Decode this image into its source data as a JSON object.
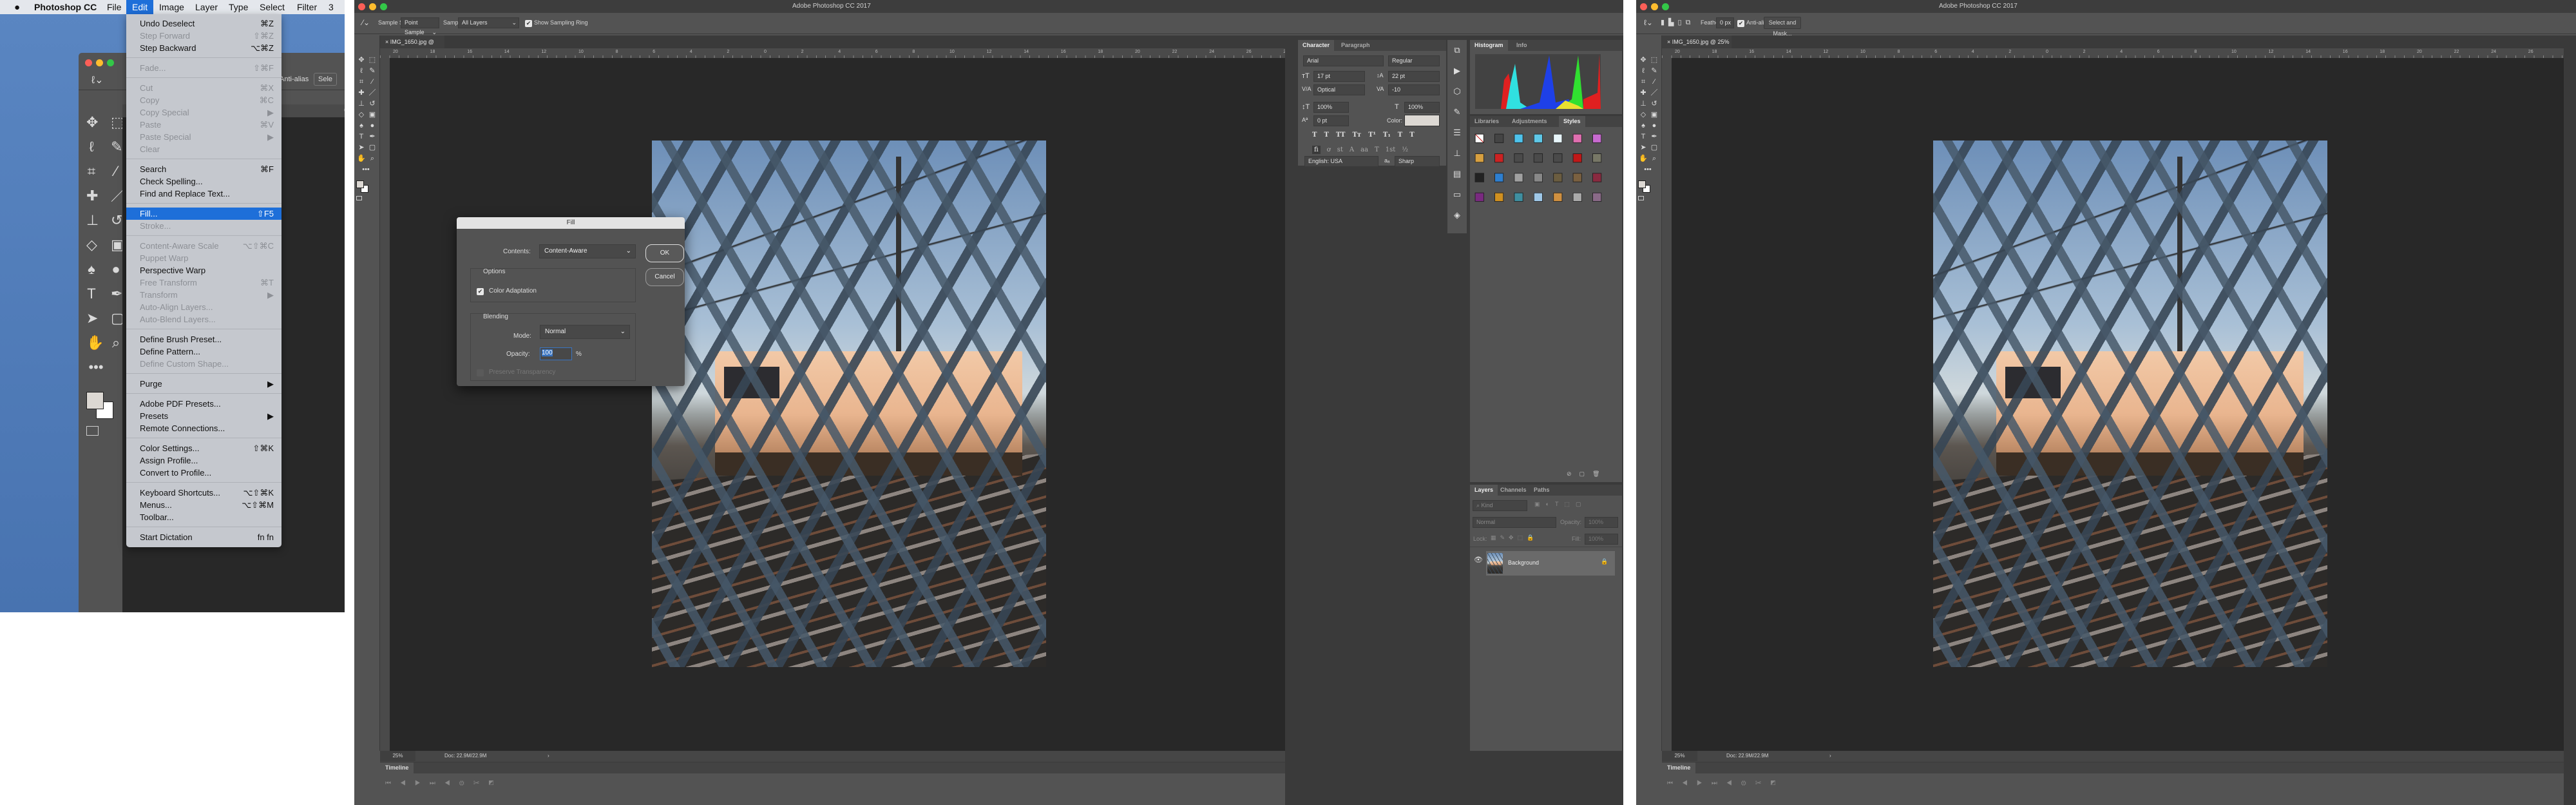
{
  "menubar": {
    "apple_icon": "apple-logo",
    "app": "Photoshop CC",
    "items": [
      "File",
      "Edit",
      "Image",
      "Layer",
      "Type",
      "Select",
      "Filter",
      "3"
    ],
    "active": "Edit"
  },
  "edit_menu": [
    {
      "label": "Undo Deselect",
      "shortcut": "⌘Z",
      "enabled": true
    },
    {
      "label": "Step Forward",
      "shortcut": "⇧⌘Z",
      "enabled": false
    },
    {
      "label": "Step Backward",
      "shortcut": "⌥⌘Z",
      "enabled": true
    },
    {
      "sep": true
    },
    {
      "label": "Fade...",
      "shortcut": "⇧⌘F",
      "enabled": false
    },
    {
      "sep": true
    },
    {
      "label": "Cut",
      "shortcut": "⌘X",
      "enabled": false
    },
    {
      "label": "Copy",
      "shortcut": "⌘C",
      "enabled": false
    },
    {
      "label": "Copy Special",
      "shortcut": "▶",
      "enabled": false
    },
    {
      "label": "Paste",
      "shortcut": "⌘V",
      "enabled": false
    },
    {
      "label": "Paste Special",
      "shortcut": "▶",
      "enabled": false
    },
    {
      "label": "Clear",
      "shortcut": "",
      "enabled": false
    },
    {
      "sep": true
    },
    {
      "label": "Search",
      "shortcut": "⌘F",
      "enabled": true
    },
    {
      "label": "Check Spelling...",
      "shortcut": "",
      "enabled": true
    },
    {
      "label": "Find and Replace Text...",
      "shortcut": "",
      "enabled": true
    },
    {
      "sep": true
    },
    {
      "label": "Fill...",
      "shortcut": "⇧F5",
      "enabled": true,
      "highlighted": true
    },
    {
      "label": "Stroke...",
      "shortcut": "",
      "enabled": false
    },
    {
      "sep": true
    },
    {
      "label": "Content-Aware Scale",
      "shortcut": "⌥⇧⌘C",
      "enabled": false
    },
    {
      "label": "Puppet Warp",
      "shortcut": "",
      "enabled": false
    },
    {
      "label": "Perspective Warp",
      "shortcut": "",
      "enabled": true
    },
    {
      "label": "Free Transform",
      "shortcut": "⌘T",
      "enabled": false
    },
    {
      "label": "Transform",
      "shortcut": "▶",
      "enabled": false
    },
    {
      "label": "Auto-Align Layers...",
      "shortcut": "",
      "enabled": false
    },
    {
      "label": "Auto-Blend Layers...",
      "shortcut": "",
      "enabled": false
    },
    {
      "sep": true
    },
    {
      "label": "Define Brush Preset...",
      "shortcut": "",
      "enabled": true
    },
    {
      "label": "Define Pattern...",
      "shortcut": "",
      "enabled": true
    },
    {
      "label": "Define Custom Shape...",
      "shortcut": "",
      "enabled": false
    },
    {
      "sep": true
    },
    {
      "label": "Purge",
      "shortcut": "▶",
      "enabled": true
    },
    {
      "sep": true
    },
    {
      "label": "Adobe PDF Presets...",
      "shortcut": "",
      "enabled": true
    },
    {
      "label": "Presets",
      "shortcut": "▶",
      "enabled": true
    },
    {
      "label": "Remote Connections...",
      "shortcut": "",
      "enabled": true
    },
    {
      "sep": true
    },
    {
      "label": "Color Settings...",
      "shortcut": "⇧⌘K",
      "enabled": true
    },
    {
      "label": "Assign Profile...",
      "shortcut": "",
      "enabled": true
    },
    {
      "label": "Convert to Profile...",
      "shortcut": "",
      "enabled": true
    },
    {
      "sep": true
    },
    {
      "label": "Keyboard Shortcuts...",
      "shortcut": "⌥⇧⌘K",
      "enabled": true
    },
    {
      "label": "Menus...",
      "shortcut": "⌥⇧⌘M",
      "enabled": true
    },
    {
      "label": "Toolbar...",
      "shortcut": "",
      "enabled": true
    },
    {
      "sep": true
    },
    {
      "label": "Start Dictation",
      "shortcut": "fn fn",
      "enabled": true
    }
  ],
  "bg_window": {
    "partial_option": "Anti-alias",
    "partial_button": "Sele",
    "ruler": [
      "6",
      "4"
    ]
  },
  "tools": [
    {
      "name": "move",
      "glyph": "✥"
    },
    {
      "name": "marquee",
      "glyph": "⬚"
    },
    {
      "name": "lasso",
      "glyph": "ℓ"
    },
    {
      "name": "quick-select",
      "glyph": "✎"
    },
    {
      "name": "crop",
      "glyph": "⌗"
    },
    {
      "name": "eyedropper",
      "glyph": "⁄"
    },
    {
      "name": "healing",
      "glyph": "✚"
    },
    {
      "name": "brush",
      "glyph": "／"
    },
    {
      "name": "stamp",
      "glyph": "⊥"
    },
    {
      "name": "history-brush",
      "glyph": "↺"
    },
    {
      "name": "eraser",
      "glyph": "◇"
    },
    {
      "name": "gradient",
      "glyph": "▣"
    },
    {
      "name": "blur",
      "glyph": "♠"
    },
    {
      "name": "dodge",
      "glyph": "●"
    },
    {
      "name": "type",
      "glyph": "T"
    },
    {
      "name": "pen",
      "glyph": "✒"
    },
    {
      "name": "path-select",
      "glyph": "➤"
    },
    {
      "name": "shape",
      "glyph": "▢"
    },
    {
      "name": "hand",
      "glyph": "✋"
    },
    {
      "name": "zoom",
      "glyph": "⌕"
    },
    {
      "name": "more",
      "glyph": "•••"
    }
  ],
  "window": {
    "title": "Adobe Photoshop CC 2017",
    "ruler_labels": [
      "20",
      "18",
      "16",
      "14",
      "12",
      "10",
      "8",
      "6",
      "4",
      "2",
      "0",
      "2",
      "4",
      "6",
      "8",
      "10",
      "12",
      "14",
      "16",
      "18",
      "20",
      "22",
      "24",
      "26",
      "28"
    ],
    "zoom": "25%",
    "doc_size": "Doc: 22.9M/22.9M",
    "timeline_tab": "Timeline"
  },
  "window2": {
    "options": {
      "sample_size_label": "Sample Size:",
      "sample_size": "Point Sample",
      "sample_label": "Sample:",
      "sample": "All Layers",
      "show_ring": "Show Sampling Ring",
      "show_ring_checked": true
    },
    "doc_tab": "IMG_1650.jpg @ 25% (RGB/8)"
  },
  "fill_dialog": {
    "title": "Fill",
    "contents_label": "Contents:",
    "contents": "Content-Aware",
    "ok": "OK",
    "cancel": "Cancel",
    "options_label": "Options",
    "color_adaptation": "Color Adaptation",
    "color_adaptation_checked": true,
    "blending_label": "Blending",
    "mode_label": "Mode:",
    "mode": "Normal",
    "opacity_label": "Opacity:",
    "opacity": "100",
    "opacity_unit": "%",
    "preserve_transparency": "Preserve Transparency",
    "preserve_checked": false
  },
  "character": {
    "tabs": [
      "Character",
      "Paragraph"
    ],
    "font": "Arial",
    "style": "Regular",
    "size": "17 pt",
    "leading": "22 pt",
    "kerning": "Optical",
    "tracking": "-10",
    "vscale": "100%",
    "hscale": "100%",
    "baseline": "0 pt",
    "color_label": "Color:",
    "color": "#dcd8d3",
    "type_styles": [
      "T",
      "T",
      "TT",
      "Tт",
      "T¹",
      "T₁",
      "T",
      "T"
    ],
    "opentype": [
      "fi",
      "ơ",
      "st",
      "A",
      "aa",
      "T",
      "1st",
      "½"
    ],
    "language": "English: USA",
    "aa_icon": "aₐ",
    "antialias": "Sharp"
  },
  "histogram": {
    "tabs": [
      "Histogram",
      "Info"
    ]
  },
  "styles": {
    "tabs": [
      "Libraries",
      "Adjustments",
      "Styles"
    ],
    "swatches": [
      "#ffffff",
      "#444444",
      "#4ec3ec",
      "#5fc8e8",
      "#e8f6fb",
      "#e06fb0",
      "#c86ad0",
      "#d8a040",
      "#cc2222",
      "#4a4a4a",
      "#4a4a4a",
      "#4a4a4a",
      "#c01818",
      "#777766",
      "#222222",
      "#2e7fd0",
      "#a0a0a0",
      "#888888",
      "#6b5d40",
      "#7a6040",
      "#8a2a40",
      "#7a2a80",
      "#d09020",
      "#3f8fa0",
      "#9fc8e8",
      "#d09040",
      "#aaaaaa",
      "#8a6a88"
    ]
  },
  "layers": {
    "tabs": [
      "Layers",
      "Channels",
      "Paths"
    ],
    "kind": "Kind",
    "blend": "Normal",
    "opacity_label": "Opacity:",
    "opacity": "100%",
    "lock_label": "Lock:",
    "fill_label": "Fill:",
    "fill": "100%",
    "layer_name": "Background"
  },
  "window3": {
    "options": {
      "feather_label": "Feather:",
      "feather": "0 px",
      "antialias": "Anti-alias",
      "antialias_checked": true,
      "select_mask": "Select and Mask..."
    },
    "doc_tab": "IMG_1650.jpg @ 25% (RGB/8) *"
  }
}
